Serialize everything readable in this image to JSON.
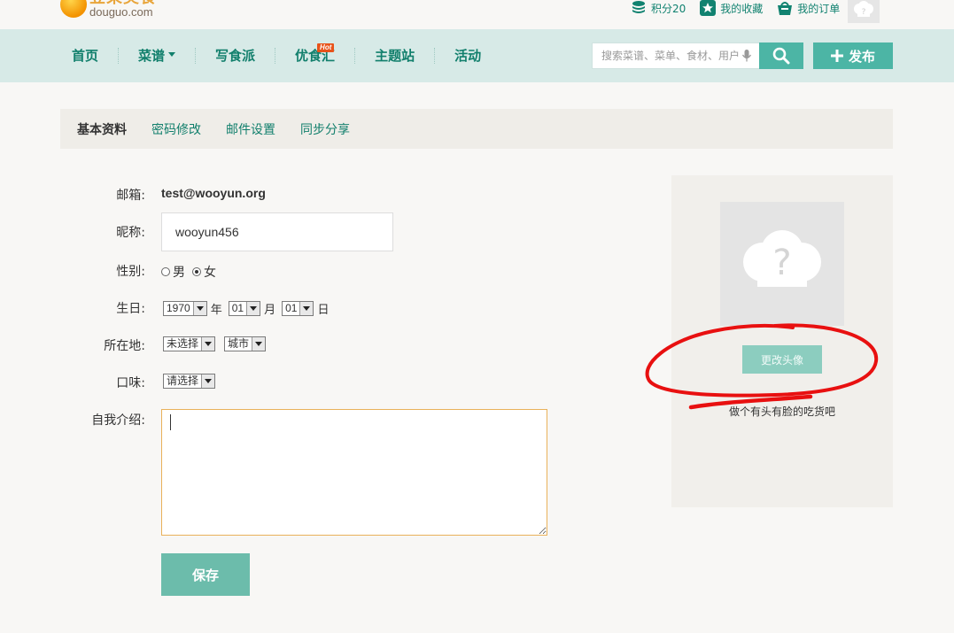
{
  "brand": {
    "name_cn": "豆果美食",
    "name_en": "douguo.com"
  },
  "top_links": [
    {
      "label": "积分20",
      "icon": "coins-icon"
    },
    {
      "label": "我的收藏",
      "icon": "star-icon"
    },
    {
      "label": "我的订单",
      "icon": "basket-icon"
    }
  ],
  "nav": {
    "items": [
      "首页",
      "菜谱",
      "写食派",
      "优食汇",
      "主题站",
      "活动"
    ],
    "hot_badge": "Hot",
    "search_placeholder": "搜索菜谱、菜单、食材、用户",
    "publish_label": "发布"
  },
  "tabs": [
    "基本资料",
    "密码修改",
    "邮件设置",
    "同步分享"
  ],
  "form": {
    "email_label": "邮箱:",
    "email_value": "test@wooyun.org",
    "nickname_label": "昵称:",
    "nickname_value": "wooyun456",
    "gender_label": "性别:",
    "gender_options": [
      "男",
      "女"
    ],
    "gender_selected": "女",
    "birthday_label": "生日:",
    "birthday": {
      "year": "1970",
      "year_unit": "年",
      "month": "01",
      "month_unit": "月",
      "day": "01",
      "day_unit": "日"
    },
    "location_label": "所在地:",
    "location_province": "未选择",
    "location_city": "城市",
    "taste_label": "口味:",
    "taste_value": "请选择",
    "intro_label": "自我介绍:",
    "intro_value": "",
    "save_label": "保存"
  },
  "avatar": {
    "change_label": "更改头像",
    "tip": "做个有头有脸的吃货吧"
  },
  "colors": {
    "brand_green": "#4cb5a5",
    "nav_bg": "#d7eae7",
    "link": "#117f6c",
    "annotation": "#e81010"
  }
}
